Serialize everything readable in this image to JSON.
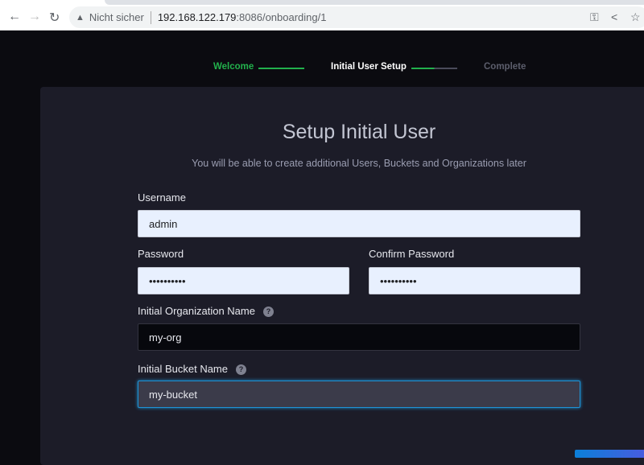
{
  "browser": {
    "security": "Nicht sicher",
    "url_host": "192.168.122.179",
    "url_path": ":8086/onboarding/1",
    "icons": [
      "back-icon",
      "forward-icon",
      "reload-icon",
      "warning-icon",
      "key-icon",
      "share-icon",
      "star-icon"
    ]
  },
  "steps": [
    {
      "label": "Welcome",
      "state": "done"
    },
    {
      "label": "Initial User Setup",
      "state": "current"
    },
    {
      "label": "Complete",
      "state": "pending"
    }
  ],
  "form": {
    "title": "Setup Initial User",
    "subtitle": "You will be able to create additional Users, Buckets and Organizations later",
    "username_label": "Username",
    "username": "admin",
    "password_label": "Password",
    "password": "••••••••••",
    "confirm_label": "Confirm Password",
    "confirm": "••••••••••",
    "org_label": "Initial Organization Name",
    "org": "my-org",
    "bucket_label": "Initial Bucket Name",
    "bucket": "my-bucket",
    "help": "?"
  },
  "colors": {
    "accent_green": "#22b14c",
    "focus_blue": "#1f93d6"
  }
}
